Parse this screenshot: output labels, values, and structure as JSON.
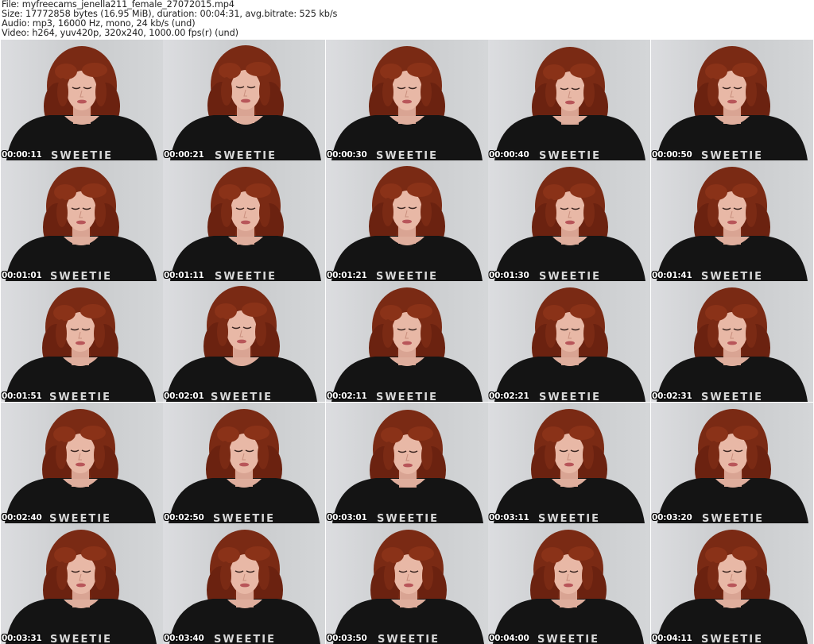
{
  "header": {
    "file": "File: myfreecams_jenella211_female_27072015.mp4",
    "size": "Size: 17772858 bytes (16.95 MiB), duration: 00:04:31, avg.bitrate: 525 kb/s",
    "audio": "Audio: mp3, 16000 Hz, mono, 24 kb/s (und)",
    "video": "Video: h264, yuv420p, 320x240, 1000.00 fps(r) (und)"
  },
  "shirt_text": "SWEETIE",
  "colors": {
    "background_wall": "#c9cbcd",
    "hair": "#7a2a14",
    "skin": "#e8b8a6",
    "shirt": "#141414",
    "timestamp_text": "#ffffff"
  },
  "thumbnails": [
    {
      "timestamp": "00:00:11"
    },
    {
      "timestamp": "00:00:21"
    },
    {
      "timestamp": "00:00:30"
    },
    {
      "timestamp": "00:00:40"
    },
    {
      "timestamp": "00:00:50"
    },
    {
      "timestamp": "00:01:01"
    },
    {
      "timestamp": "00:01:11"
    },
    {
      "timestamp": "00:01:21"
    },
    {
      "timestamp": "00:01:30"
    },
    {
      "timestamp": "00:01:41"
    },
    {
      "timestamp": "00:01:51"
    },
    {
      "timestamp": "00:02:01"
    },
    {
      "timestamp": "00:02:11"
    },
    {
      "timestamp": "00:02:21"
    },
    {
      "timestamp": "00:02:31"
    },
    {
      "timestamp": "00:02:40"
    },
    {
      "timestamp": "00:02:50"
    },
    {
      "timestamp": "00:03:01"
    },
    {
      "timestamp": "00:03:11"
    },
    {
      "timestamp": "00:03:20"
    },
    {
      "timestamp": "00:03:31"
    },
    {
      "timestamp": "00:03:40"
    },
    {
      "timestamp": "00:03:50"
    },
    {
      "timestamp": "00:04:00"
    },
    {
      "timestamp": "00:04:11"
    }
  ]
}
